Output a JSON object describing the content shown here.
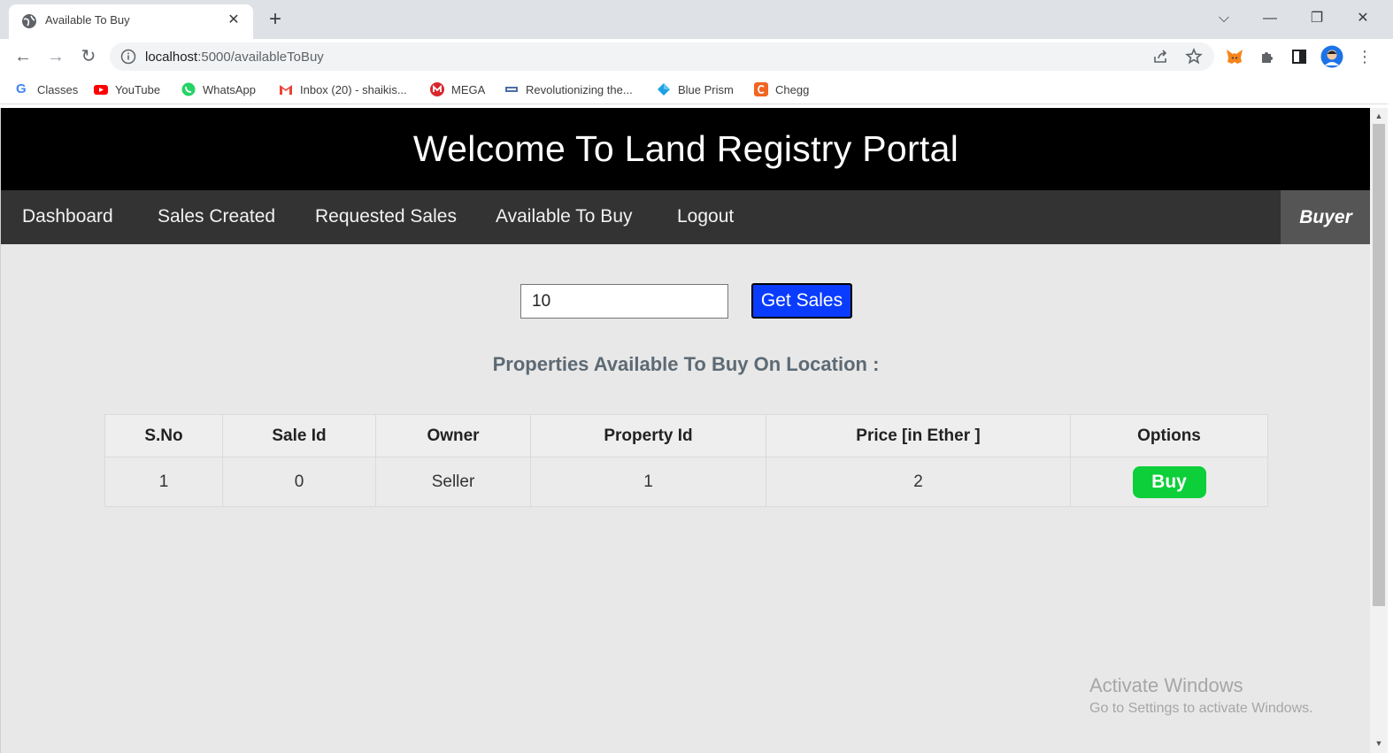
{
  "browser": {
    "tab_title": "Available To Buy",
    "url_host": "localhost",
    "url_path": ":5000/availableToBuy",
    "bookmarks": [
      {
        "label": "Classes",
        "icon": "google-icon",
        "color": "#4285f4"
      },
      {
        "label": "YouTube",
        "icon": "youtube-icon",
        "color": "#ff0000"
      },
      {
        "label": "WhatsApp",
        "icon": "whatsapp-icon",
        "color": "#25d366"
      },
      {
        "label": "Inbox (20) - shaikis...",
        "icon": "gmail-icon",
        "color": "#ea4335"
      },
      {
        "label": "MEGA",
        "icon": "mega-icon",
        "color": "#d9272e"
      },
      {
        "label": "Revolutionizing the...",
        "icon": "page-icon",
        "color": "#4a6fa5"
      },
      {
        "label": "Blue Prism",
        "icon": "blue-prism-icon",
        "color": "#1ea0e6"
      },
      {
        "label": "Chegg",
        "icon": "chegg-icon",
        "color": "#f26522"
      }
    ]
  },
  "page": {
    "header_title": "Welcome To Land Registry Portal",
    "nav": {
      "dashboard": "Dashboard",
      "sales_created": "Sales Created",
      "requested_sales": "Requested Sales",
      "available_to_buy": "Available To Buy",
      "logout": "Logout",
      "role": "Buyer"
    },
    "location_input_value": "10",
    "get_sales_label": "Get Sales",
    "subtitle": "Properties Available To Buy On Location :",
    "table": {
      "headers": [
        "S.No",
        "Sale Id",
        "Owner",
        "Property Id",
        "Price [in Ether ]",
        "Options"
      ],
      "rows": [
        {
          "sno": "1",
          "sale_id": "0",
          "owner": "Seller",
          "property_id": "1",
          "price": "2",
          "action": "Buy"
        }
      ]
    },
    "accent_colors": {
      "get_sales": "#0a3cff",
      "buy": "#0ccf3a"
    }
  },
  "os_watermark": {
    "line1": "Activate Windows",
    "line2": "Go to Settings to activate Windows."
  }
}
